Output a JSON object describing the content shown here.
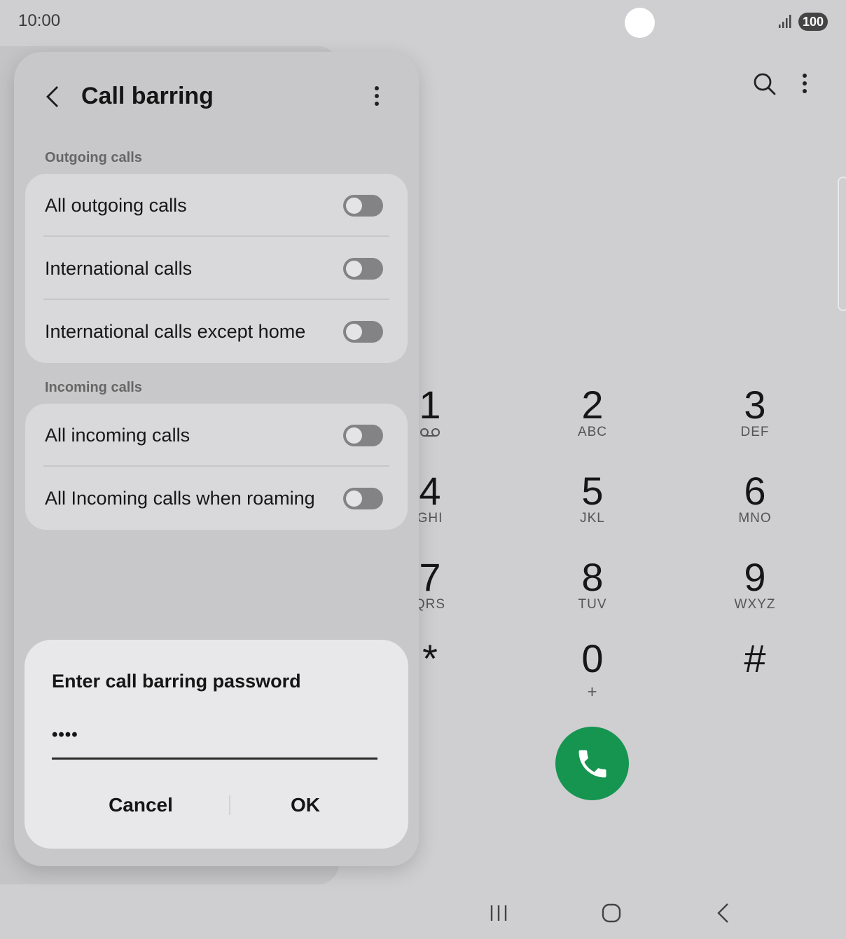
{
  "status_bar": {
    "time": "10:00",
    "battery": "100"
  },
  "dialer": {
    "keys": [
      {
        "digit": "1",
        "letters": "",
        "voicemail": true
      },
      {
        "digit": "2",
        "letters": "ABC"
      },
      {
        "digit": "3",
        "letters": "DEF"
      },
      {
        "digit": "4",
        "letters": "GHI"
      },
      {
        "digit": "5",
        "letters": "JKL"
      },
      {
        "digit": "6",
        "letters": "MNO"
      },
      {
        "digit": "7",
        "letters": "QRS"
      },
      {
        "digit": "8",
        "letters": "TUV"
      },
      {
        "digit": "9",
        "letters": "WXYZ"
      },
      {
        "digit": "*",
        "letters": ""
      },
      {
        "digit": "0",
        "letters": "+"
      },
      {
        "digit": "#",
        "letters": ""
      }
    ],
    "call_button_color": "#169551"
  },
  "panel": {
    "title": "Call barring",
    "sections": [
      {
        "label": "Outgoing calls",
        "items": [
          {
            "label": "All outgoing calls",
            "enabled": false
          },
          {
            "label": "International calls",
            "enabled": false
          },
          {
            "label": "International calls except home",
            "enabled": false
          }
        ]
      },
      {
        "label": "Incoming calls",
        "items": [
          {
            "label": "All incoming calls",
            "enabled": false
          },
          {
            "label": "All Incoming calls when roaming",
            "enabled": false
          }
        ]
      }
    ]
  },
  "dialog": {
    "title": "Enter call barring password",
    "password_value": "••••",
    "cancel_label": "Cancel",
    "ok_label": "OK"
  }
}
